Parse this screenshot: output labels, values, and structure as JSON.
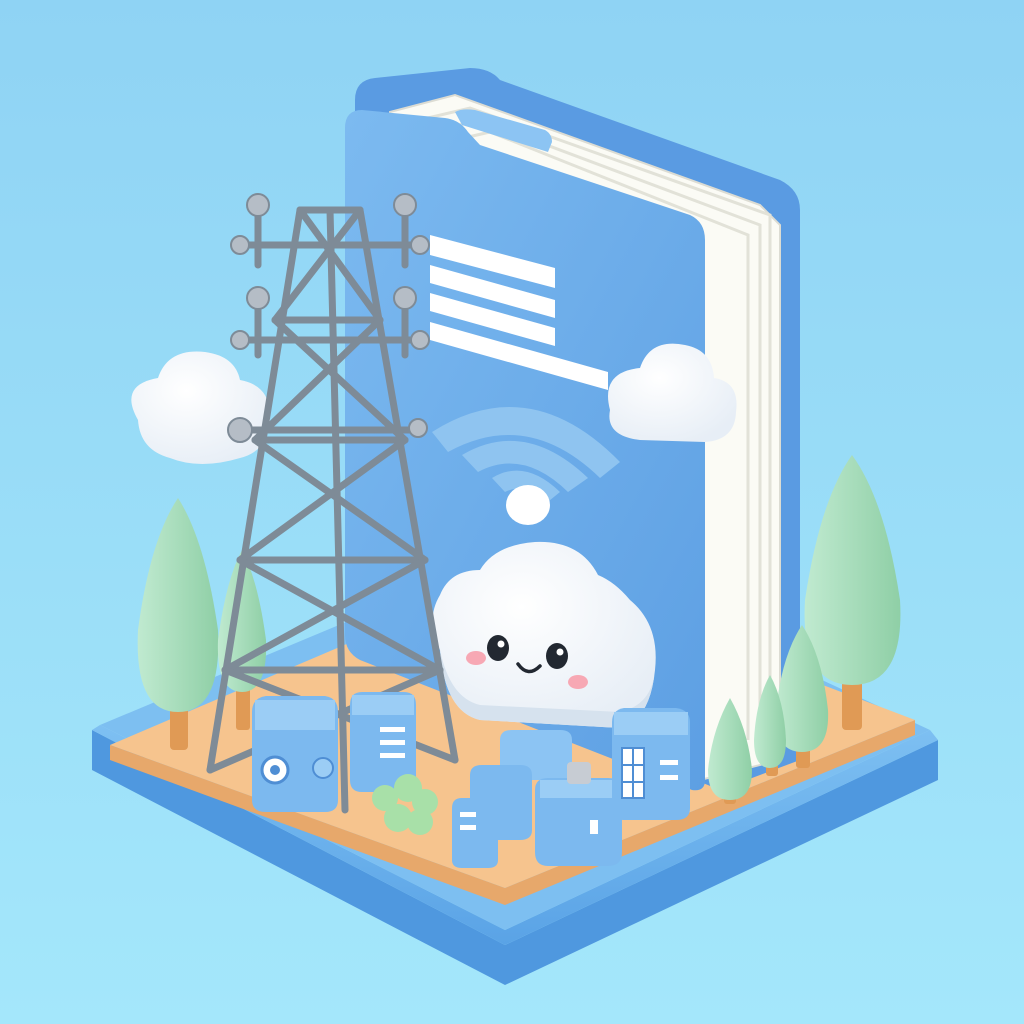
{
  "scene": {
    "subject": "",
    "colors": {
      "background_top": "#8fd3f4",
      "background_bottom": "#a4e7fb",
      "base_blue": "#6fb4ee",
      "platform_orange": "#f6c48e",
      "folder_blue": "#69abea",
      "paper_white": "#fbfbf5",
      "tower_gray": "#8e9aa6",
      "tree_green": "#a7dcb6",
      "trunk_orange": "#e09a55",
      "cloud_white": "#ffffff",
      "cheek_pink": "#f7a8b4"
    },
    "icons": [
      "folder-icon",
      "wifi-icon",
      "cell-tower-icon",
      "cloud-icon",
      "tree-icon",
      "server-box-icon"
    ]
  }
}
